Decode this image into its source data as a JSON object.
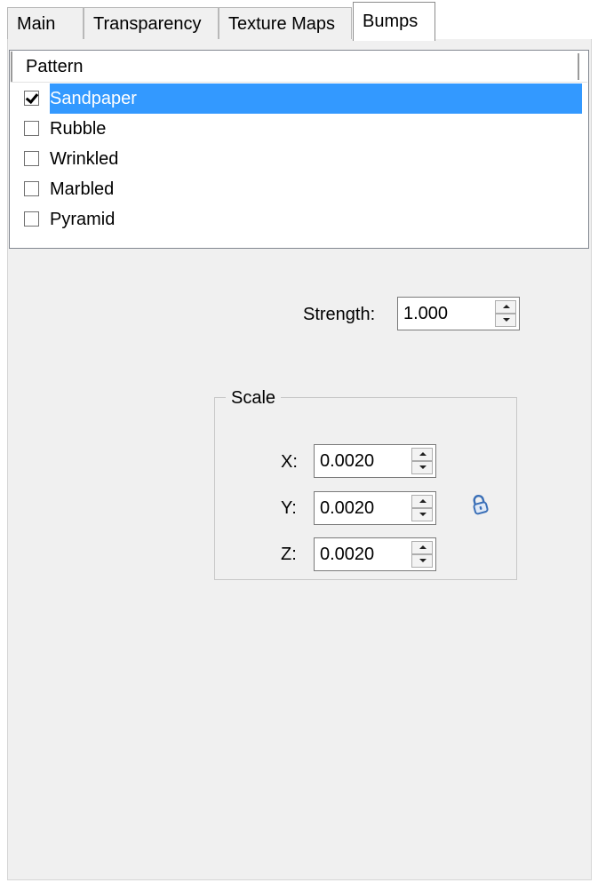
{
  "tabs": [
    {
      "label": "Main",
      "active": false
    },
    {
      "label": "Transparency",
      "active": false
    },
    {
      "label": "Texture Maps",
      "active": false
    },
    {
      "label": "Bumps",
      "active": true
    }
  ],
  "pattern_list": {
    "header": "Pattern",
    "items": [
      {
        "label": "Sandpaper",
        "checked": true,
        "selected": true
      },
      {
        "label": "Rubble",
        "checked": false,
        "selected": false
      },
      {
        "label": "Wrinkled",
        "checked": false,
        "selected": false
      },
      {
        "label": "Marbled",
        "checked": false,
        "selected": false
      },
      {
        "label": "Pyramid",
        "checked": false,
        "selected": false
      }
    ]
  },
  "strength": {
    "label": "Strength:",
    "value": "1.000"
  },
  "scale": {
    "title": "Scale",
    "x_label": "X:",
    "x_value": "0.0020",
    "y_label": "Y:",
    "y_value": "0.0020",
    "z_label": "Z:",
    "z_value": "0.0020",
    "lock_icon": "lock-icon"
  },
  "colors": {
    "selection": "#3399ff",
    "panel_bg": "#f0f0f0",
    "lock_icon": "#3a6fb7"
  }
}
